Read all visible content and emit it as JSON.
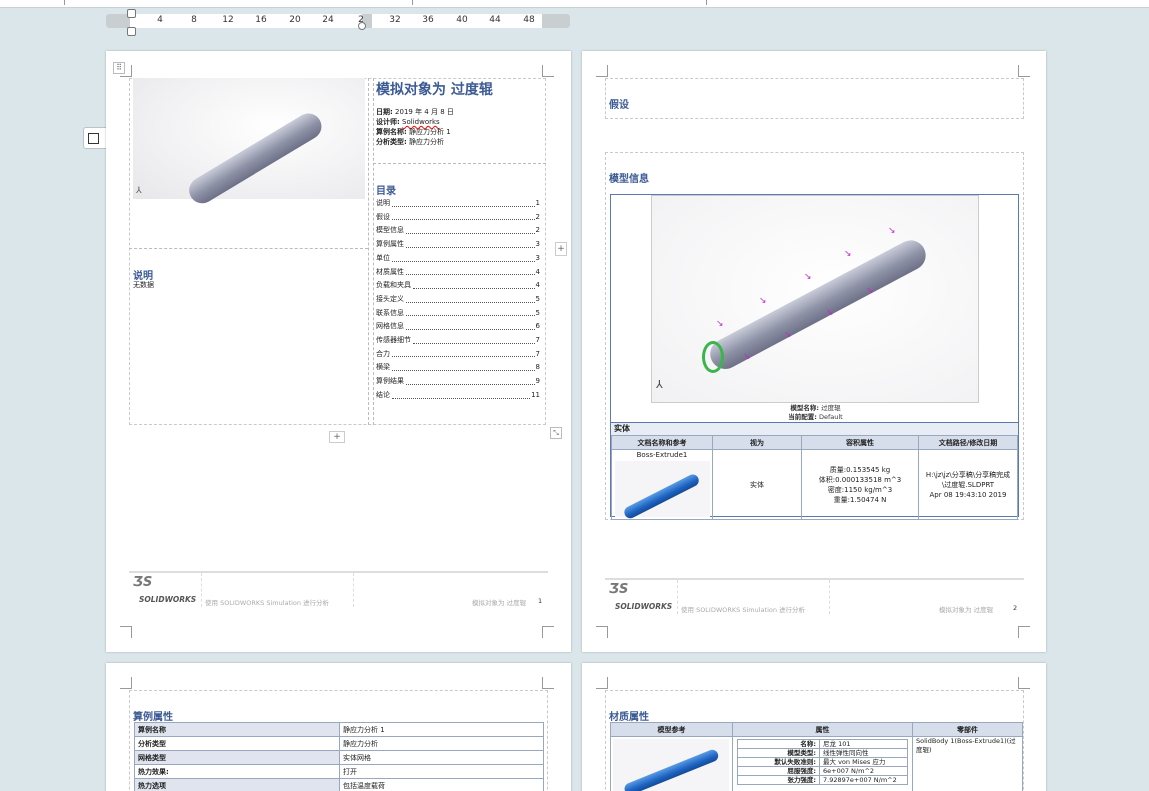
{
  "ruler": {
    "ticks": [
      "4",
      "8",
      "12",
      "16",
      "20",
      "24",
      "2",
      "32",
      "36",
      "40",
      "44",
      "48"
    ]
  },
  "page1": {
    "title": "模拟对象为  过度辊",
    "meta": [
      {
        "label": "日期:",
        "value": "2019 年 4 月 8 日"
      },
      {
        "label": "设计师:",
        "value": "Solidworks"
      },
      {
        "label": "算例名称:",
        "value": "静应力分析 1"
      },
      {
        "label": "分析类型:",
        "value": "静应力分析"
      }
    ],
    "toc_heading": "目录",
    "toc": [
      {
        "t": "说明",
        "p": "1"
      },
      {
        "t": "假设",
        "p": "2"
      },
      {
        "t": "模型信息",
        "p": "2"
      },
      {
        "t": "算例属性",
        "p": "3"
      },
      {
        "t": "单位",
        "p": "3"
      },
      {
        "t": "材质属性",
        "p": "4"
      },
      {
        "t": "负载和夹具",
        "p": "4"
      },
      {
        "t": "接头定义",
        "p": "5"
      },
      {
        "t": "联系信息",
        "p": "5"
      },
      {
        "t": "网格信息",
        "p": "6"
      },
      {
        "t": "传感器细节",
        "p": "7"
      },
      {
        "t": "合力",
        "p": "7"
      },
      {
        "t": "横梁",
        "p": "8"
      },
      {
        "t": "算例结果",
        "p": "9"
      },
      {
        "t": "结论",
        "p": "11"
      }
    ],
    "desc_heading": "说明",
    "desc_text": "无数据",
    "footer_logo": "SOLIDWORKS",
    "footer_text": "使用 SOLIDWORKS Simulation 进行分析",
    "footer_right": "模拟对象为 过度辊",
    "page_no": "1"
  },
  "page2": {
    "assume_heading": "假设",
    "model_heading": "模型信息",
    "model_name_label": "模型名称:",
    "model_name": "过度辊",
    "config_label": "当前配置:",
    "config": "Default",
    "solid_heading": "实体",
    "cols": [
      "文档名称和参考",
      "视为",
      "容积属性",
      "文档路径/修改日期"
    ],
    "body_name": "Boss-Extrude1",
    "treated_as": "实体",
    "props": [
      "质量:0.153545 kg",
      "体积:0.000133518 m^3",
      "密度:1150 kg/m^3",
      "重量:1.50474 N"
    ],
    "path": [
      "H:\\jz\\jz\\分享稿\\分享稿完成",
      "\\过度辊.SLDPRT",
      "Apr 08 19:43:10 2019"
    ],
    "footer_logo": "SOLIDWORKS",
    "footer_text": "使用 SOLIDWORKS Simulation 进行分析",
    "footer_right": "模拟对象为 过度辊",
    "page_no": "2"
  },
  "page3": {
    "heading": "算例属性",
    "rows": [
      {
        "k": "算例名称",
        "v": "静应力分析 1"
      },
      {
        "k": "分析类型",
        "v": "静应力分析"
      },
      {
        "k": "网格类型",
        "v": "实体网格"
      },
      {
        "k": "热力效果:",
        "v": "打开"
      },
      {
        "k": "热力选项",
        "v": "包括温度载荷"
      }
    ]
  },
  "page4": {
    "heading": "材质属性",
    "cols": [
      "模型参考",
      "属性",
      "零部件"
    ],
    "props": [
      {
        "k": "名称:",
        "v": "尼龙 101"
      },
      {
        "k": "模型类型:",
        "v": "线性弹性同向性"
      },
      {
        "k": "默认失败准则:",
        "v": "最大 von Mises 应力"
      },
      {
        "k": "屈服强度:",
        "v": "6e+007 N/m^2"
      },
      {
        "k": "张力强度:",
        "v": "7.92897e+007 N/m^2"
      }
    ],
    "component": "SolidBody 1(Boss-Extrude1)(过度辊)"
  }
}
